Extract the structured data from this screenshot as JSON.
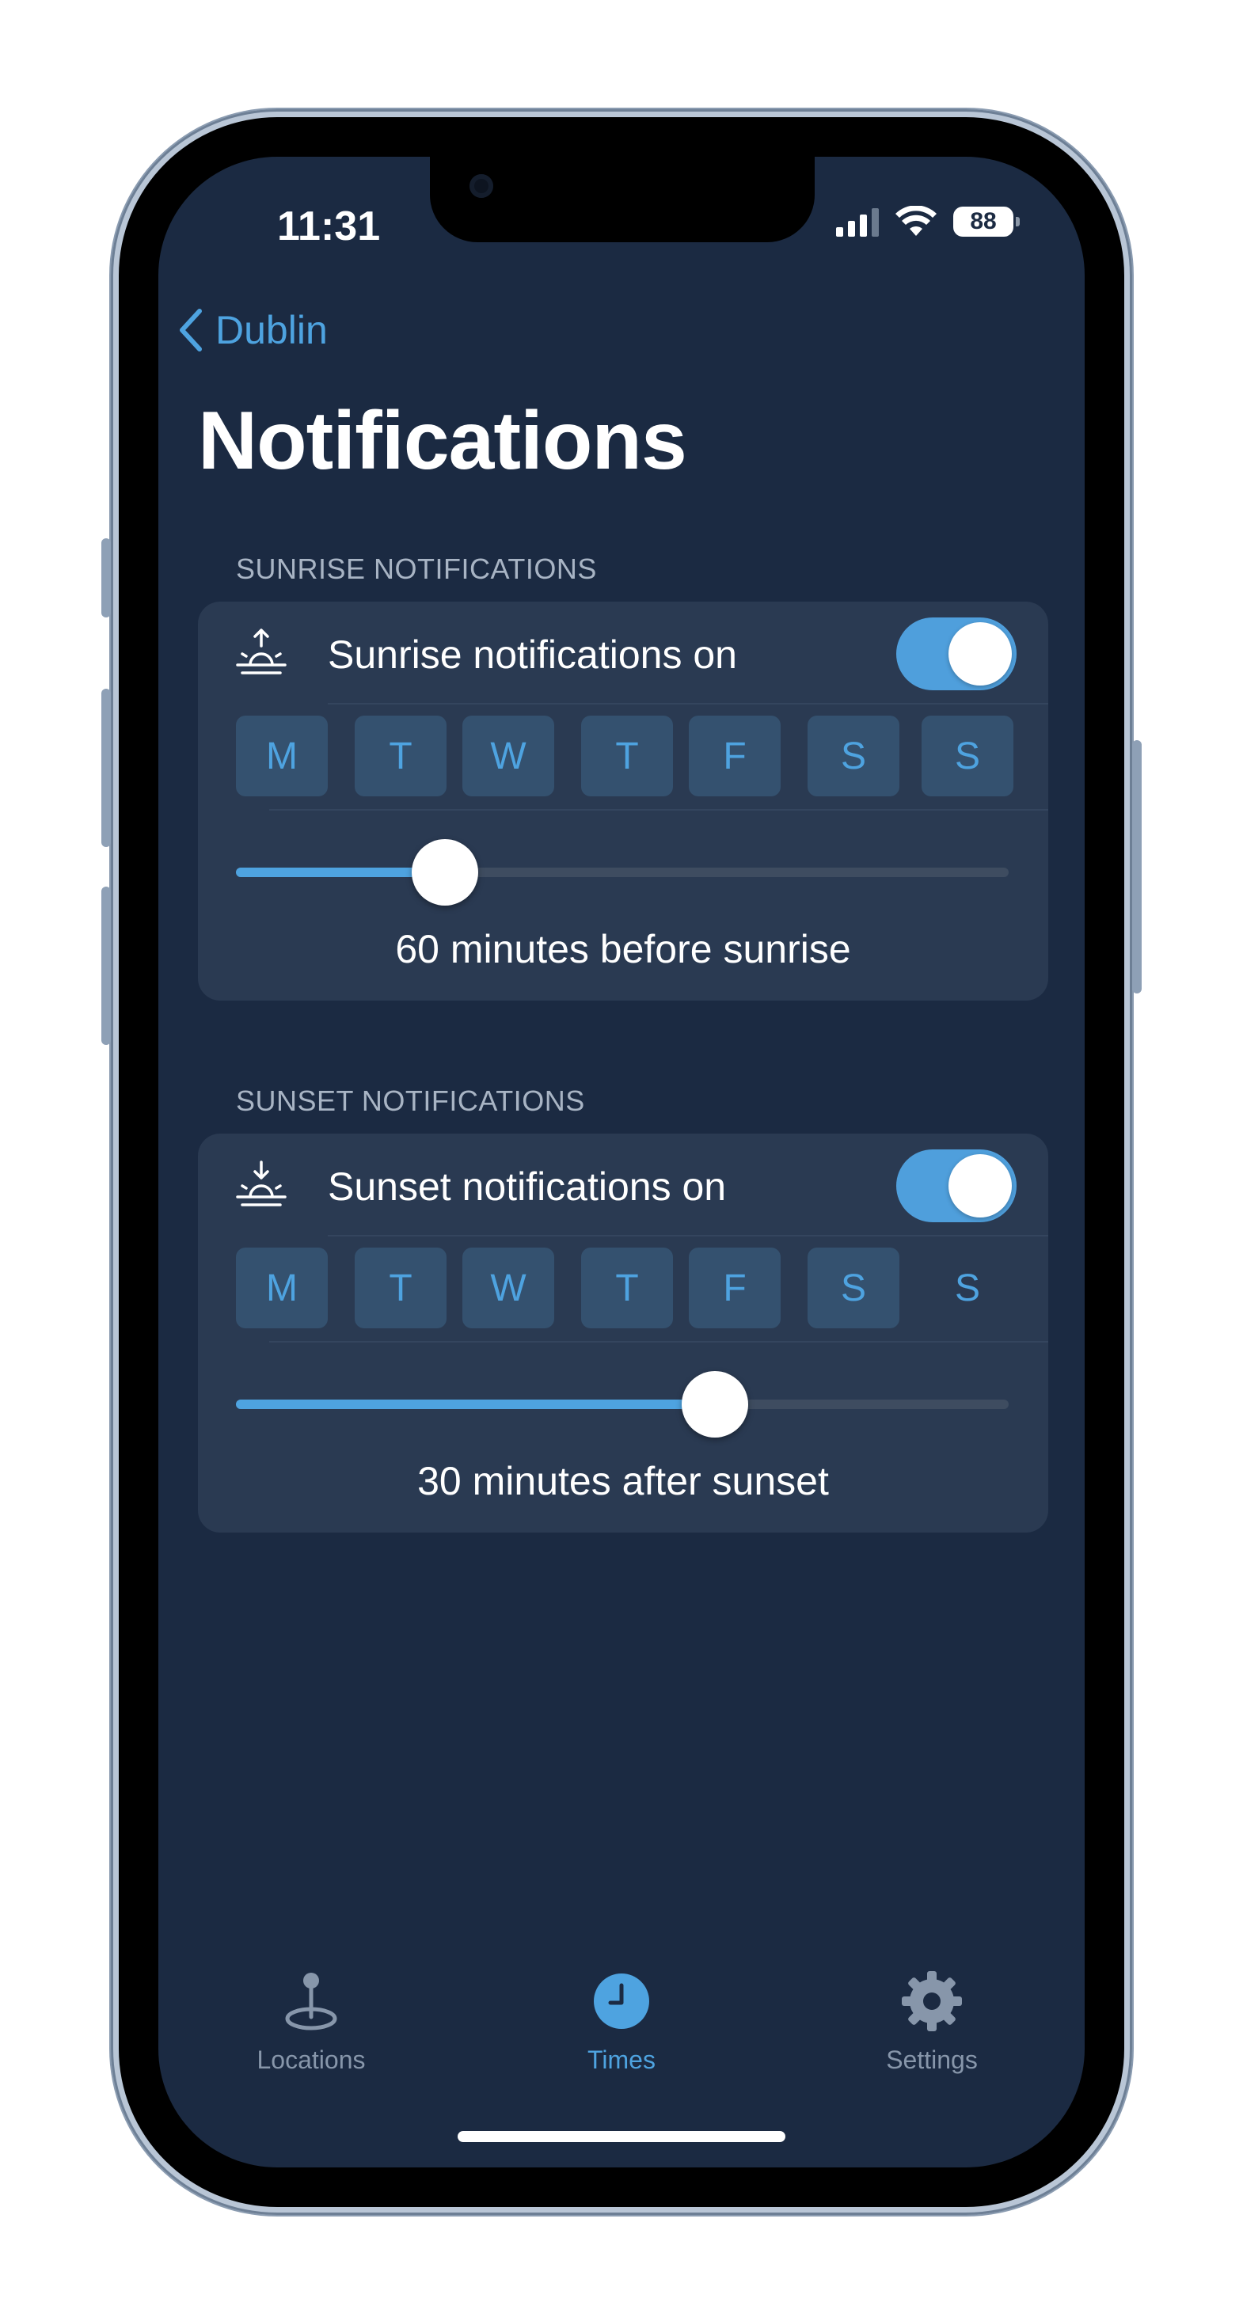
{
  "status_bar": {
    "time": "11:31",
    "battery": "88"
  },
  "nav": {
    "back_label": "Dublin"
  },
  "page_title": "Notifications",
  "sunrise": {
    "section_header": "SUNRISE NOTIFICATIONS",
    "toggle_label": "Sunrise notifications on",
    "toggle_on": true,
    "days": [
      {
        "label": "M",
        "selected": true
      },
      {
        "label": "T",
        "selected": true
      },
      {
        "label": "W",
        "selected": true
      },
      {
        "label": "T",
        "selected": true
      },
      {
        "label": "F",
        "selected": true
      },
      {
        "label": "S",
        "selected": true
      },
      {
        "label": "S",
        "selected": true
      }
    ],
    "slider_fraction": 0.27,
    "caption": "60 minutes before sunrise"
  },
  "sunset": {
    "section_header": "SUNSET NOTIFICATIONS",
    "toggle_label": "Sunset notifications on",
    "toggle_on": true,
    "days": [
      {
        "label": "M",
        "selected": true
      },
      {
        "label": "T",
        "selected": true
      },
      {
        "label": "W",
        "selected": true
      },
      {
        "label": "T",
        "selected": true
      },
      {
        "label": "F",
        "selected": true
      },
      {
        "label": "S",
        "selected": true
      },
      {
        "label": "S",
        "selected": false
      }
    ],
    "slider_fraction": 0.62,
    "caption": "30 minutes after sunset"
  },
  "tabbar": {
    "items": [
      {
        "label": "Locations",
        "icon": "location-pin-icon",
        "active": false
      },
      {
        "label": "Times",
        "icon": "clock-icon",
        "active": true
      },
      {
        "label": "Settings",
        "icon": "gear-icon",
        "active": false
      }
    ]
  },
  "colors": {
    "background": "#1b2a42",
    "card": "#2a3a52",
    "accent": "#4ea3e0",
    "secondary_text": "#a8b4c4"
  }
}
